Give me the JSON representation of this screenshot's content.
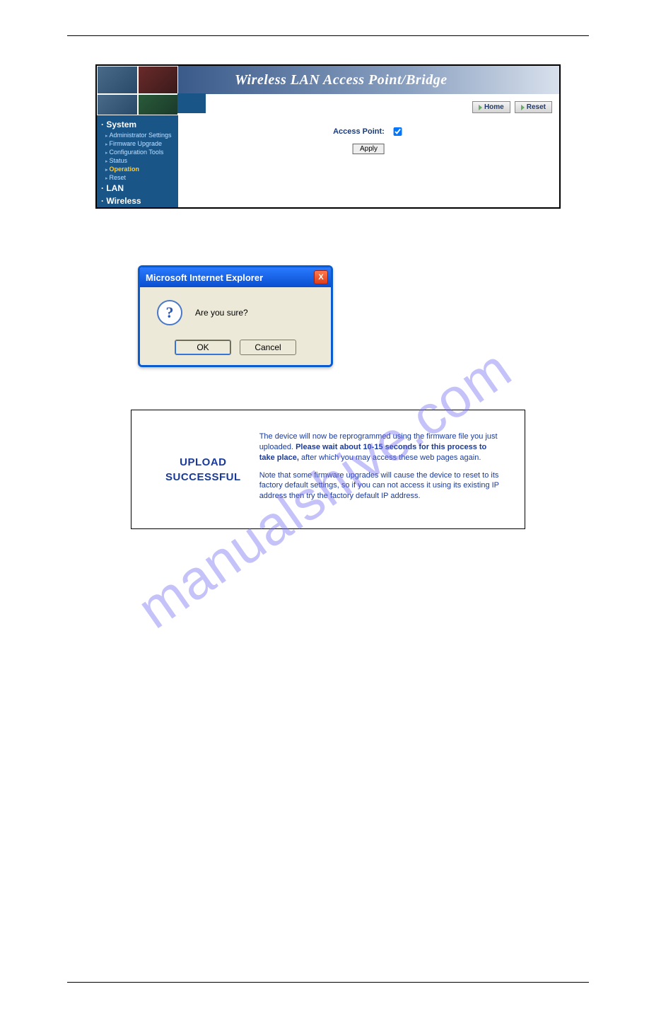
{
  "watermark": "manualshive.com",
  "shot1": {
    "banner_title": "Wireless LAN Access Point/Bridge",
    "buttons": {
      "home": "Home",
      "reset": "Reset"
    },
    "form": {
      "label": "Access Point:",
      "apply": "Apply"
    },
    "nav": {
      "system_head": "System",
      "items": [
        "Administrator Settings",
        "Firmware Upgrade",
        "Configuration Tools",
        "Status",
        "Operation",
        "Reset"
      ],
      "lan_head": "LAN",
      "wireless_head": "Wireless"
    }
  },
  "shot2": {
    "title": "Microsoft Internet Explorer",
    "message": "Are you sure?",
    "ok": "OK",
    "cancel": "Cancel",
    "close_glyph": "X",
    "question_glyph": "?"
  },
  "shot3": {
    "heading": "UPLOAD\nSUCCESSFUL",
    "p1_a": "The device will now be reprogrammed using the firmware file you just uploaded. ",
    "p1_b": "Please wait about 10-15 seconds for this process to take place,",
    "p1_c": " after which you may access these web pages again.",
    "p2": "Note that some firmware upgrades will cause the device to reset to its factory default settings, so if you can not access it using its existing IP address then try the factory default IP address."
  }
}
